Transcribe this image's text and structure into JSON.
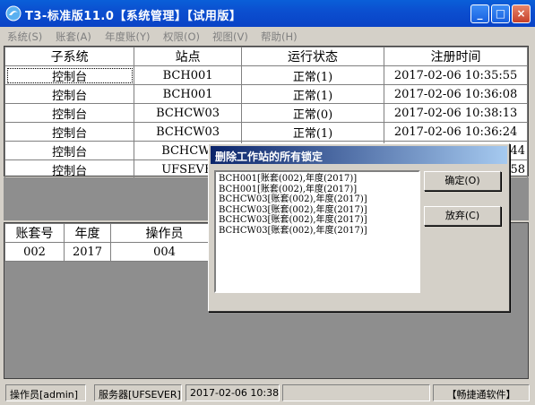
{
  "window": {
    "title": "T3-标准版11.0【系统管理】【试用版】",
    "minimize_label": "_",
    "maximize_label": "□",
    "close_label": "×"
  },
  "menu": [
    {
      "label": "系统(S)"
    },
    {
      "label": "账套(A)"
    },
    {
      "label": "年度账(Y)"
    },
    {
      "label": "权限(O)"
    },
    {
      "label": "视图(V)"
    },
    {
      "label": "帮助(H)"
    }
  ],
  "main_table": {
    "headers": [
      "子系统",
      "站点",
      "运行状态",
      "注册时间"
    ],
    "rows": [
      [
        "控制台",
        "BCH001",
        "正常(1)",
        "2017-02-06 10:35:55"
      ],
      [
        "控制台",
        "BCH001",
        "正常(1)",
        "2017-02-06 10:36:08"
      ],
      [
        "控制台",
        "BCHCW03",
        "正常(0)",
        "2017-02-06 10:38:13"
      ],
      [
        "控制台",
        "BCHCW03",
        "正常(1)",
        "2017-02-06 10:36:24"
      ],
      [
        "控制台",
        "BCHCW0",
        "",
        "44"
      ],
      [
        "控制台",
        "UFSEVE",
        "",
        "58"
      ]
    ]
  },
  "lower_table": {
    "headers": [
      "账套号",
      "年度",
      "操作员"
    ],
    "rows": [
      [
        "002",
        "2017",
        "004"
      ]
    ]
  },
  "dialog": {
    "title": "删除工作站的所有锁定",
    "items": [
      "BCH001[账套(002),年度(2017)]",
      "BCH001[账套(002),年度(2017)]",
      "BCHCW03[账套(002),年度(2017)]",
      "BCHCW03[账套(002),年度(2017)]",
      "BCHCW03[账套(002),年度(2017)]",
      "BCHCW03[账套(002),年度(2017)]"
    ],
    "ok_label": "确定(O)",
    "cancel_label": "放弃(C)"
  },
  "statusbar": {
    "operator": "操作员[admin]",
    "server": "服务器[UFSEVER]",
    "datetime": "2017-02-06 10:38",
    "vendor": "【畅捷通软件】"
  }
}
